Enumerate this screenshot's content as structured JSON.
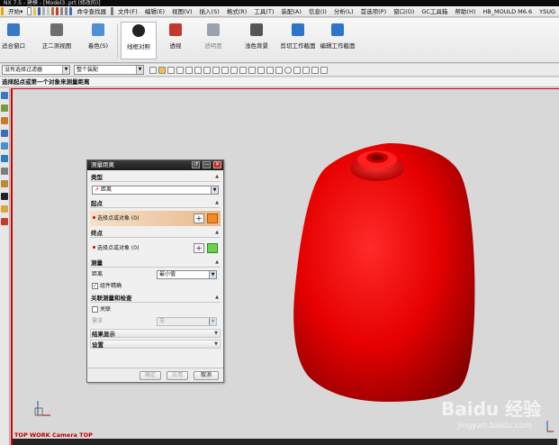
{
  "titlebar": {
    "text": "NX 7.5 - 建模 - [Model3 .prt (修改的)]"
  },
  "menubar": {
    "start": "开始▾",
    "items": [
      "文件(F)",
      "编辑(E)",
      "视图(V)",
      "插入(S)",
      "格式(R)",
      "工具(T)",
      "装配(A)",
      "信息(I)",
      "分析(L)",
      "首选项(P)",
      "窗口(O)",
      "GC工具箱",
      "帮助(H)"
    ],
    "command_finder": "命令查找器",
    "plugins": [
      "HB_MOULD M6.6",
      "YSUG"
    ]
  },
  "ribbon": {
    "buttons": [
      {
        "label": "适合窗口",
        "icon": "fit-icon",
        "color": "#3b78c4"
      },
      {
        "label": "正二测视图",
        "icon": "trimetric-icon",
        "color": "#6d6d6d"
      },
      {
        "label": "着色(S)",
        "icon": "shaded-icon",
        "color": "#4f8fd6"
      },
      {
        "label": "线框对照",
        "icon": "wireframe-icon",
        "color": "#222222"
      },
      {
        "label": "透视",
        "icon": "perspective-icon",
        "color": "#c0392b"
      },
      {
        "label": "透明度",
        "icon": "translucency-icon",
        "color": "#9aa3ad"
      },
      {
        "label": "浅色背景",
        "icon": "background-icon",
        "color": "#555555"
      },
      {
        "label": "剪切工作截面",
        "icon": "clip-section-icon",
        "color": "#2e74c8"
      },
      {
        "label": "编辑工作截面",
        "icon": "edit-section-icon",
        "color": "#2e74c8"
      }
    ]
  },
  "selectionbar": {
    "filter": "没有选择过滤器",
    "scope": "整个装配"
  },
  "cue": "选择起点或第一个对象来测量距离",
  "viewport": {
    "camera_label": "TOP WORK Camera TOP",
    "part_color": "#e00000",
    "watermark": {
      "main": "Baidu 经验",
      "sub": "jingyan.baidu.com"
    }
  },
  "dialog": {
    "title": "测量距离",
    "type_group": {
      "header": "类型",
      "value": "距离"
    },
    "start_group": {
      "header": "起点",
      "select_text": "选择点或对象 (0)"
    },
    "end_group": {
      "header": "终点",
      "select_text": "选择点或对象 (0)"
    },
    "measure_group": {
      "header": "测量",
      "distance_label": "距离",
      "distance_value": "最小值",
      "fine_label": "组件精确",
      "fine_checked": true
    },
    "assoc_group": {
      "header": "关联测量和检查",
      "assoc_label": "关联",
      "assoc_checked": false,
      "req_label": "需求",
      "req_value": "无"
    },
    "results_header": "结果显示",
    "settings_header": "设置",
    "footer": {
      "ok": "确定",
      "apply": "应用",
      "cancel": "取消"
    }
  }
}
